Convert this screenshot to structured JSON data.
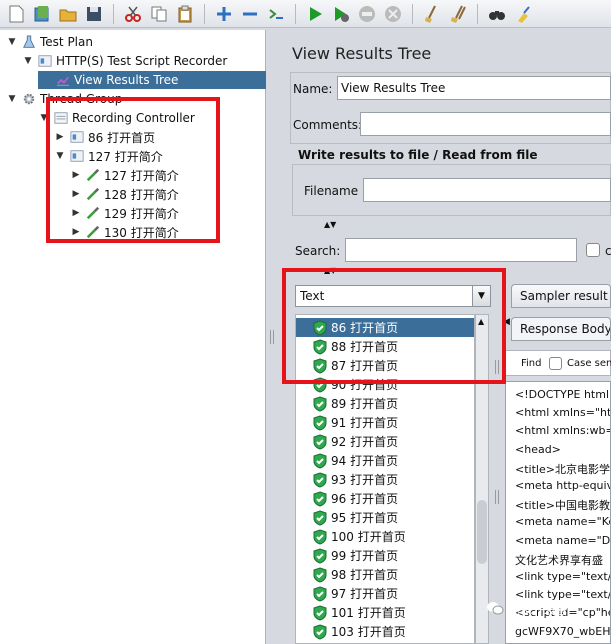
{
  "toolbar": {
    "icons": [
      "new-icon",
      "templates-icon",
      "open-icon",
      "save-icon",
      "cut-icon",
      "copy-icon",
      "paste-icon",
      "expand-icon",
      "collapse-icon",
      "toggle-icon",
      "start-icon",
      "start-no-pause-icon",
      "stop-icon",
      "shutdown-icon",
      "clear-icon",
      "clear-all-icon",
      "search-icon",
      "reset-search-icon"
    ]
  },
  "tree": {
    "items": [
      {
        "label": "Test Plan"
      },
      {
        "label": "HTTP(S) Test Script Recorder"
      },
      {
        "label": "View Results Tree"
      },
      {
        "label": "Thread Group"
      },
      {
        "label": "Recording Controller"
      },
      {
        "label": "86 打开首页"
      },
      {
        "label": "127 打开简介"
      },
      {
        "label": "127 打开简介"
      },
      {
        "label": "128 打开简介"
      },
      {
        "label": "129 打开简介"
      },
      {
        "label": "130 打开简介"
      }
    ]
  },
  "panel": {
    "title": "View Results Tree",
    "name_label": "Name:",
    "name_value": "View Results Tree",
    "comments_label": "Comments:",
    "comments_value": "",
    "file_group_title": "Write results to file / Read from file",
    "filename_label": "Filename",
    "filename_value": "",
    "search_label": "Search:",
    "search_value": "",
    "renderer_selected": "Text",
    "tabs": {
      "sampler_result": "Sampler result",
      "response_body": "Response Body"
    },
    "find_label": "Find",
    "case_label": "Case sen"
  },
  "results": [
    {
      "label": "86 打开首页",
      "selected": true
    },
    {
      "label": "88 打开首页"
    },
    {
      "label": "87 打开首页"
    },
    {
      "label": "90 打开首页"
    },
    {
      "label": "89 打开首页"
    },
    {
      "label": "91 打开首页"
    },
    {
      "label": "92 打开首页"
    },
    {
      "label": "94 打开首页"
    },
    {
      "label": "93 打开首页"
    },
    {
      "label": "96 打开首页"
    },
    {
      "label": "95 打开首页"
    },
    {
      "label": "100 打开首页"
    },
    {
      "label": "99 打开首页"
    },
    {
      "label": "98 打开首页"
    },
    {
      "label": "97 打开首页"
    },
    {
      "label": "101 打开首页"
    },
    {
      "label": "103 打开首页"
    }
  ],
  "response_lines": [
    "<!DOCTYPE html",
    "<html xmlns=\"http",
    "<html xmlns:wb=\"",
    "<head>",
    "<title>北京电影学院",
    "<meta http-equiv=",
    "<title>中国电影教育",
    "<meta name=\"Ke",
    "<meta name=\"De",
    "文化艺术界享有盛",
    "<link type=\"text/cs",
    "<link type=\"text/cs",
    "<script id=\"cp\"hefw",
    "gcWF9X70_wbEH"
  ],
  "watermark": "测试开发营"
}
